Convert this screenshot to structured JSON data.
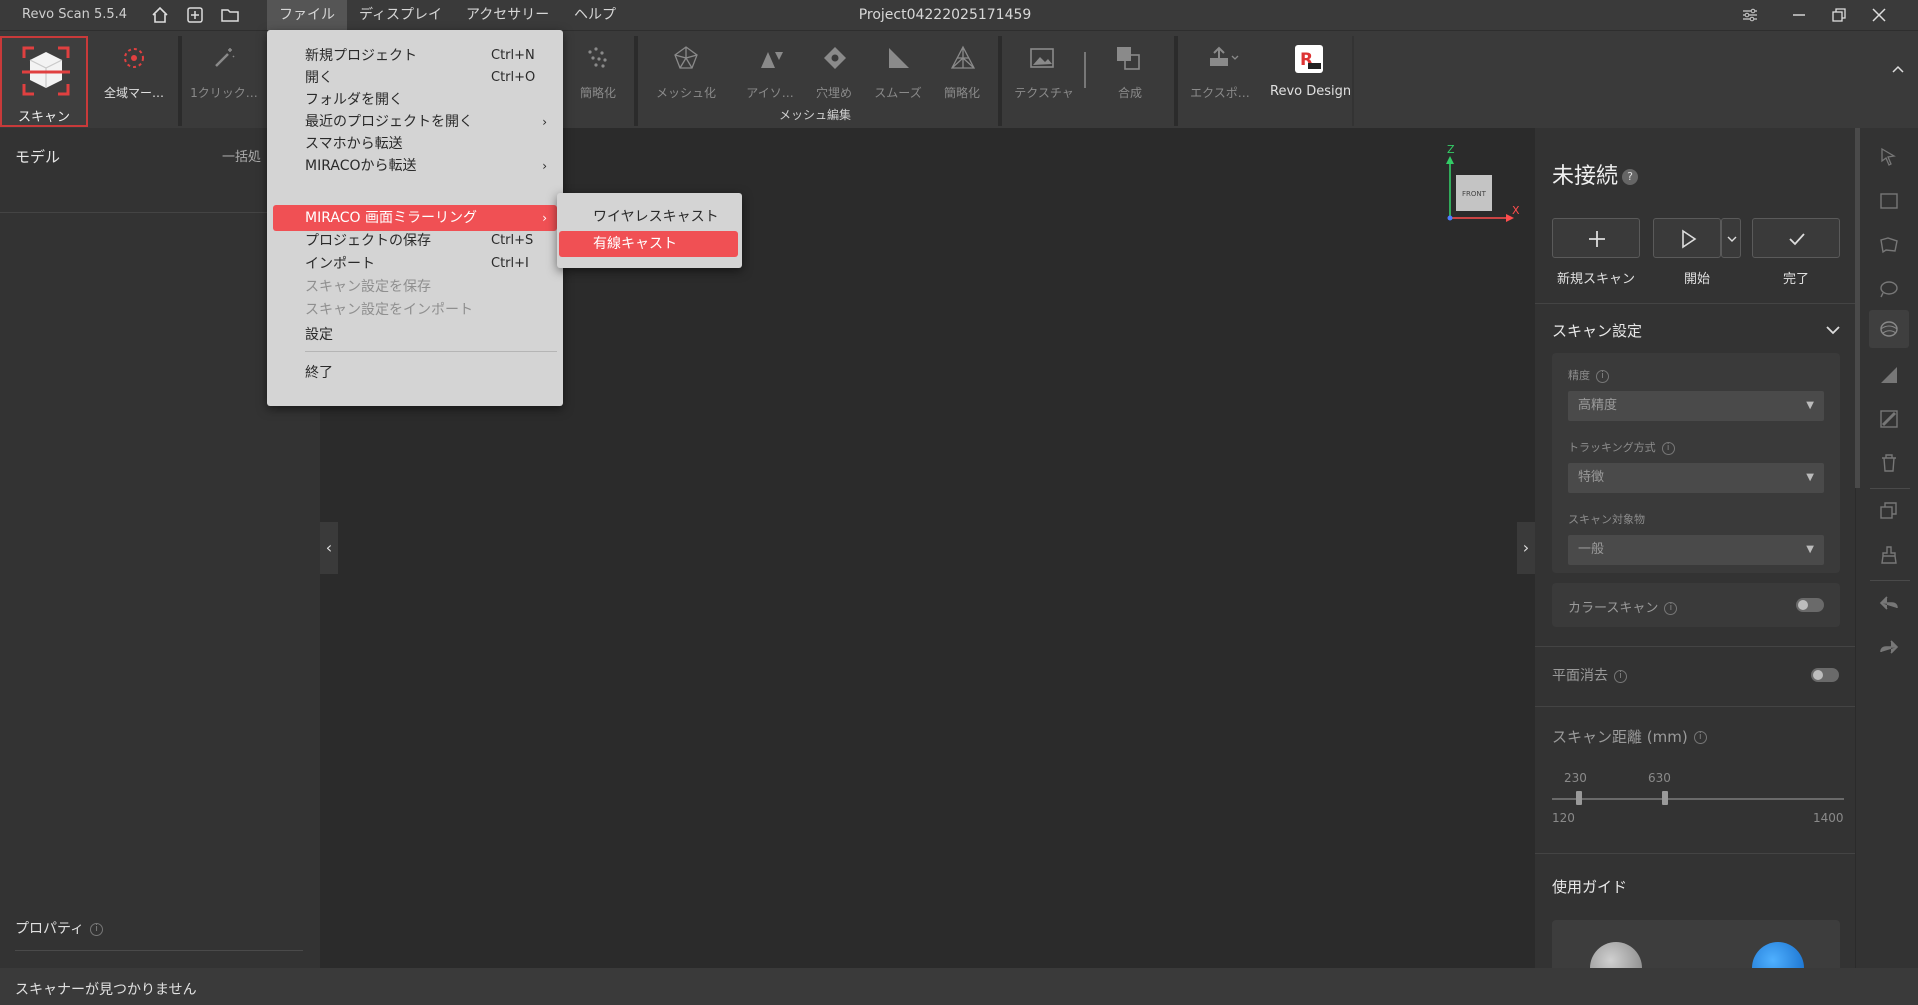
{
  "app": {
    "name": "Revo Scan 5.5.4",
    "project": "Project04222025171459"
  },
  "menubar": [
    {
      "label": "ファイル",
      "active": true
    },
    {
      "label": "ディスプレイ"
    },
    {
      "label": "アクセサリー"
    },
    {
      "label": "ヘルプ"
    }
  ],
  "toolbar": {
    "scan": "スキャン",
    "global_marker": "全域マー…",
    "one_click": "1クリック…",
    "simplify1": "簡略化",
    "meshing": "メッシュ化",
    "isolate": "アイソ…",
    "fill_holes": "穴埋め",
    "smooth": "スムーズ",
    "simplify2": "簡略化",
    "texture": "テクスチャ",
    "merge": "合成",
    "export": "エクスポ…",
    "revo_design": "Revo Design",
    "mesh_edit_group": "メッシュ編集"
  },
  "file_menu": {
    "items": [
      {
        "label": "新規プロジェクト",
        "shortcut": "Ctrl+N"
      },
      {
        "label": "開く",
        "shortcut": "Ctrl+O"
      },
      {
        "label": "フォルダを開く"
      },
      {
        "label": "最近のプロジェクトを開く",
        "submenu": true
      },
      {
        "label": "スマホから転送"
      },
      {
        "label": "MIRACOから転送",
        "submenu": true
      },
      {
        "label": "MIRACO 画面ミラーリング",
        "submenu": true,
        "highlighted": true
      },
      {
        "label": "プロジェクトの保存",
        "shortcut": "Ctrl+S"
      },
      {
        "label": "インポート",
        "shortcut": "Ctrl+I"
      },
      {
        "label": "スキャン設定を保存",
        "disabled": true
      },
      {
        "label": "スキャン設定をインポート",
        "disabled": true
      },
      {
        "label": "設定"
      },
      {
        "label": "終了"
      }
    ],
    "submenu": [
      {
        "label": "ワイヤレスキャスト"
      },
      {
        "label": "有線キャスト",
        "highlighted": true
      }
    ]
  },
  "left_panel": {
    "title": "モデル",
    "batch": "一括処",
    "properties": "プロパティ"
  },
  "right_panel": {
    "status": "未接続",
    "actions": {
      "new_scan": "新規スキャン",
      "start": "開始",
      "done": "完了"
    },
    "scan_settings": {
      "title": "スキャン設定",
      "precision_label": "精度",
      "precision_value": "高精度",
      "tracking_label": "トラッキング方式",
      "tracking_value": "特徴",
      "object_label": "スキャン対象物",
      "object_value": "一般",
      "color_scan": "カラースキャン"
    },
    "plane_removal": "平面消去",
    "scan_distance": {
      "title": "スキャン距離 (mm)",
      "low": "230",
      "high": "630",
      "min": "120",
      "max": "1400"
    },
    "guide": "使用ガイド"
  },
  "gizmo": {
    "z": "Z",
    "x": "X",
    "face": "FRONT"
  },
  "status_bar": "スキャナーが見つかりません",
  "colors": {
    "accent": "#f05054",
    "bg": "#2b2b2b",
    "panel": "#333333"
  }
}
